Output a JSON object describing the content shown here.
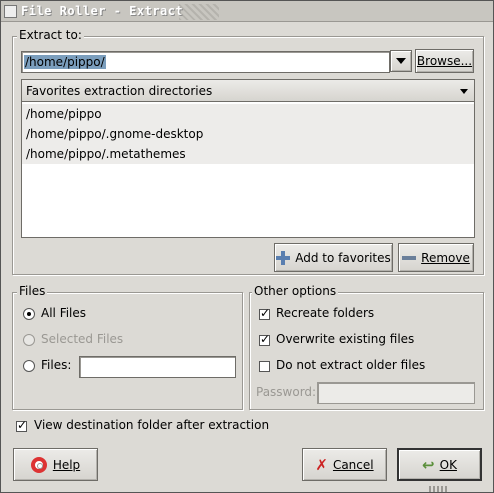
{
  "window": {
    "title": "File Roller - Extract"
  },
  "extract_to": {
    "label": "Extract to:",
    "path_value": "/home/pippo/",
    "browse_label": "Browse..."
  },
  "favorites": {
    "header": "Favorites extraction directories",
    "items": [
      "/home/pippo",
      "/home/pippo/.gnome-desktop",
      "/home/pippo/.metathemes"
    ],
    "add_label": "Add to favorites",
    "remove_label": "Remove"
  },
  "files": {
    "label": "Files",
    "all_files": "All Files",
    "selected_files": "Selected Files",
    "files_label": "Files:",
    "files_value": "",
    "selected_option": "All Files"
  },
  "other_options": {
    "label": "Other options",
    "recreate_folders": {
      "label": "Recreate folders",
      "checked": true
    },
    "overwrite_files": {
      "label": "Overwrite existing files",
      "checked": true
    },
    "no_older_files": {
      "label": "Do not extract older files",
      "checked": false
    },
    "password_label": "Password:",
    "password_value": ""
  },
  "view_destination": {
    "label": "View destination folder after extraction",
    "checked": true
  },
  "footer": {
    "help_label": "Help",
    "cancel_label": "Cancel",
    "ok_label": "OK"
  },
  "colors": {
    "selection": "#7b9ebd",
    "dialog_bg": "#dcdad5"
  }
}
